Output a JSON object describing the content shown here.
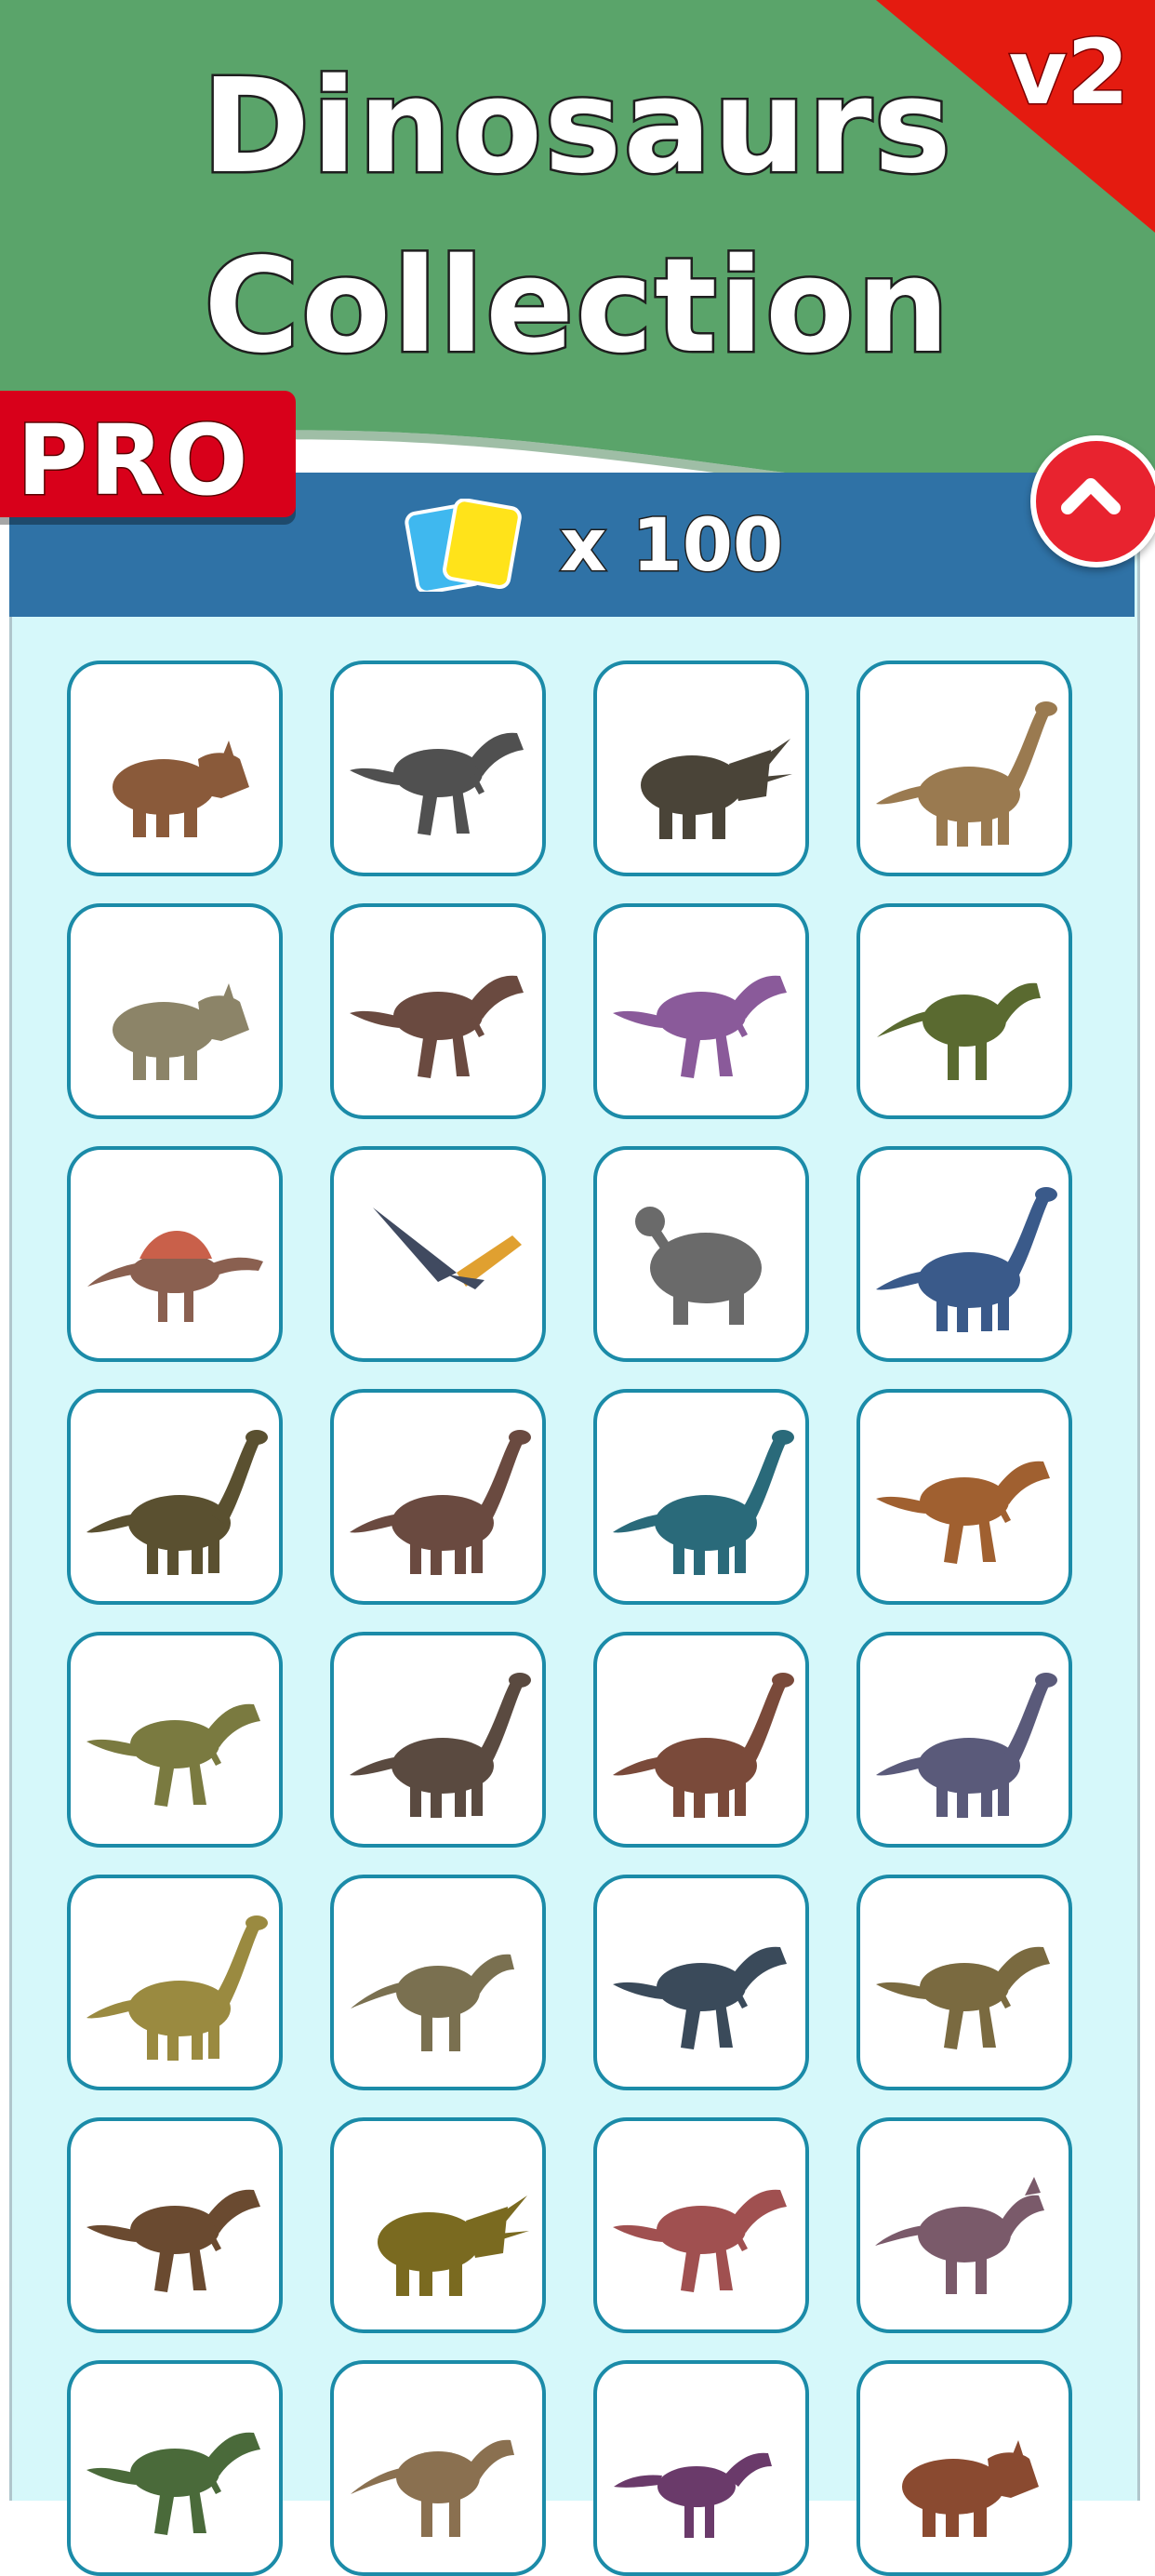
{
  "header": {
    "title_line1": "Dinosaurs",
    "title_line2": "Collection",
    "version_badge": "v2",
    "pro_badge": "PRO"
  },
  "panel": {
    "currency_icon": "cards-icon",
    "count": "x 100",
    "close_icon": "close-icon"
  },
  "colors": {
    "banner_green": "#5aa46a",
    "version_red": "#e41b10",
    "pro_red": "#d8001a",
    "header_blue": "#2f72a6",
    "panel_bg": "#d6f8fa",
    "tile_border": "#1b8ba8"
  },
  "dinosaurs": [
    {
      "icon": "ceratopsian-icon",
      "color": "#8a5a3a"
    },
    {
      "icon": "theropod-icon",
      "color": "#505050"
    },
    {
      "icon": "triceratops-icon",
      "color": "#4a4438"
    },
    {
      "icon": "sauropod-icon",
      "color": "#9a7a50"
    },
    {
      "icon": "ceratopsian-icon",
      "color": "#8c8468"
    },
    {
      "icon": "theropod-icon",
      "color": "#6a4a40"
    },
    {
      "icon": "theropod-icon",
      "color": "#8a5a9a"
    },
    {
      "icon": "ornithopod-icon",
      "color": "#5a6a30"
    },
    {
      "icon": "spinosaur-icon",
      "color": "#8a6050"
    },
    {
      "icon": "pterosaur-icon",
      "color": "#404a60"
    },
    {
      "icon": "ankylosaur-icon",
      "color": "#6a6a6a"
    },
    {
      "icon": "sauropod-icon",
      "color": "#3a5a8a"
    },
    {
      "icon": "sauropod-icon",
      "color": "#5a5030"
    },
    {
      "icon": "sauropod-icon",
      "color": "#6a4a40"
    },
    {
      "icon": "sauropod-icon",
      "color": "#2a6a7a"
    },
    {
      "icon": "theropod-icon",
      "color": "#a06030"
    },
    {
      "icon": "theropod-icon",
      "color": "#7a7a40"
    },
    {
      "icon": "sauropod-icon",
      "color": "#5a4a40"
    },
    {
      "icon": "sauropod-icon",
      "color": "#7a4a3a"
    },
    {
      "icon": "sauropod-icon",
      "color": "#5a5a7a"
    },
    {
      "icon": "sauropod-icon",
      "color": "#9a8a40"
    },
    {
      "icon": "ornithopod-icon",
      "color": "#7a7050"
    },
    {
      "icon": "theropod-icon",
      "color": "#3a4a5a"
    },
    {
      "icon": "theropod-icon",
      "color": "#7a6a40"
    },
    {
      "icon": "theropod-icon",
      "color": "#6a4a30"
    },
    {
      "icon": "triceratops-icon",
      "color": "#7a6a20"
    },
    {
      "icon": "theropod-icon",
      "color": "#a05050"
    },
    {
      "icon": "hadrosaur-icon",
      "color": "#7a5a6a"
    },
    {
      "icon": "theropod-icon",
      "color": "#4a6a3a"
    },
    {
      "icon": "ornithopod-icon",
      "color": "#8a7050"
    },
    {
      "icon": "raptor-icon",
      "color": "#6a3a6a"
    },
    {
      "icon": "ceratopsian-icon",
      "color": "#8a4a30"
    }
  ]
}
